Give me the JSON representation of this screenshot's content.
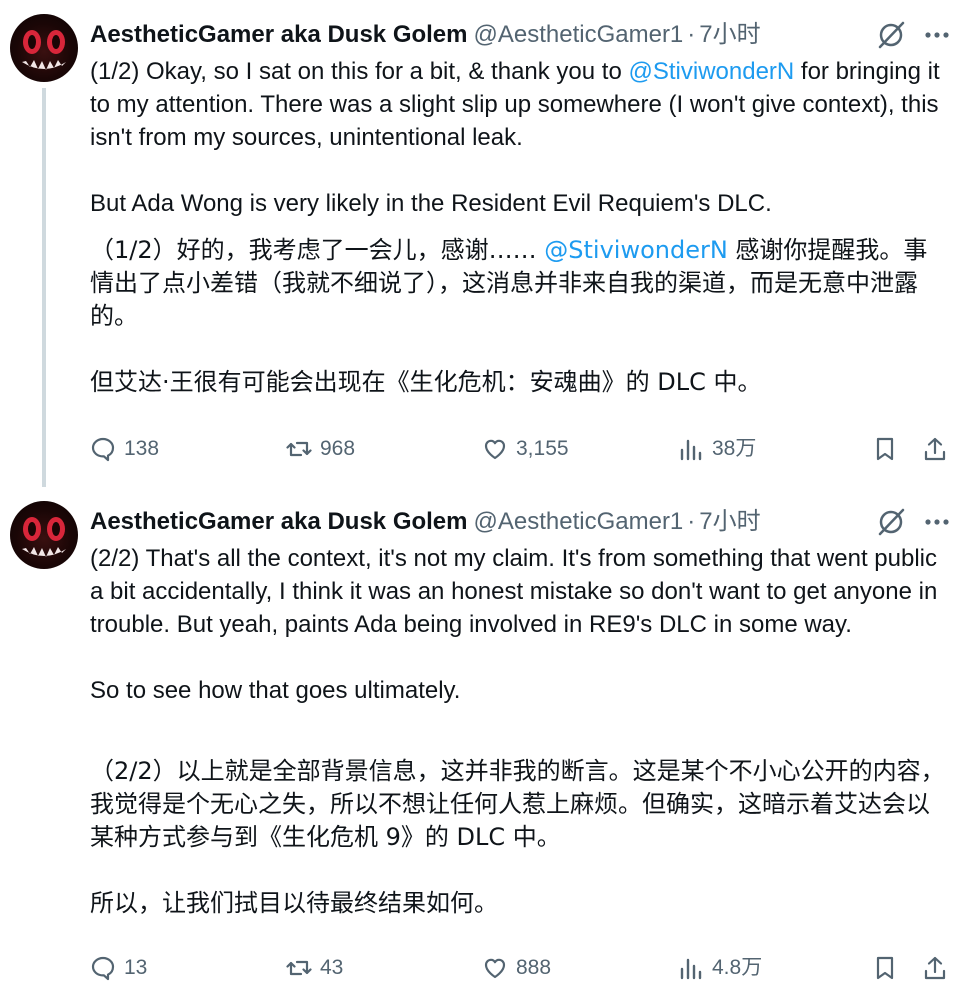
{
  "tweets": [
    {
      "name": "AestheticGamer aka Dusk Golem",
      "handle": "@AestheticGamer1",
      "separator": "·",
      "time": "7小时",
      "para1_pre": "(1/2) Okay, so I sat on this for a bit, & thank you to ",
      "para1_mention": "@StiviwonderN",
      "para1_post": " for bringing it to my attention. There was a slight slip up somewhere (I won't give context), this isn't from my sources, unintentional leak.",
      "para2": "But Ada Wong is very likely in the Resident Evil Requiem's DLC.",
      "trans1_pre": "（1/2）好的，我考虑了一会儿，感谢…… ",
      "trans1_mention": "@StiviwonderN",
      "trans1_post": " 感谢你提醒我。事情出了点小差错（我就不细说了），这消息并非来自我的渠道，而是无意中泄露的。",
      "trans2": "但艾达·王很有可能会出现在《生化危机：安魂曲》的 DLC 中。",
      "replies": "138",
      "reposts": "968",
      "likes": "3,155",
      "views": "38万"
    },
    {
      "name": "AestheticGamer aka Dusk Golem",
      "handle": "@AestheticGamer1",
      "separator": "·",
      "time": "7小时",
      "para1": "(2/2) That's all the context, it's not my claim. It's from something that went public a bit accidentally, I think it was an honest mistake so don't want to get anyone in trouble. But yeah, paints Ada being involved in RE9's DLC in some way.",
      "para2": "So to see how that goes ultimately.",
      "trans1": "（2/2）以上就是全部背景信息，这并非我的断言。这是某个不小心公开的内容，我觉得是个无心之失，所以不想让任何人惹上麻烦。但确实，这暗示着艾达会以某种方式参与到《生化危机 9》的 DLC 中。",
      "trans2": "所以，让我们拭目以待最终结果如何。",
      "replies": "13",
      "reposts": "43",
      "likes": "888",
      "views": "4.8万"
    }
  ],
  "icons": {
    "reply": "reply-icon",
    "repost": "repost-icon",
    "like": "heart-icon",
    "views": "views-icon",
    "bookmark": "bookmark-icon",
    "share": "share-icon",
    "grok": "grok-icon",
    "more": "more-icon"
  },
  "colors": {
    "link": "#1d9bf0",
    "muted": "#536471",
    "text": "#0f1419",
    "thread_line": "#cfd9de"
  }
}
